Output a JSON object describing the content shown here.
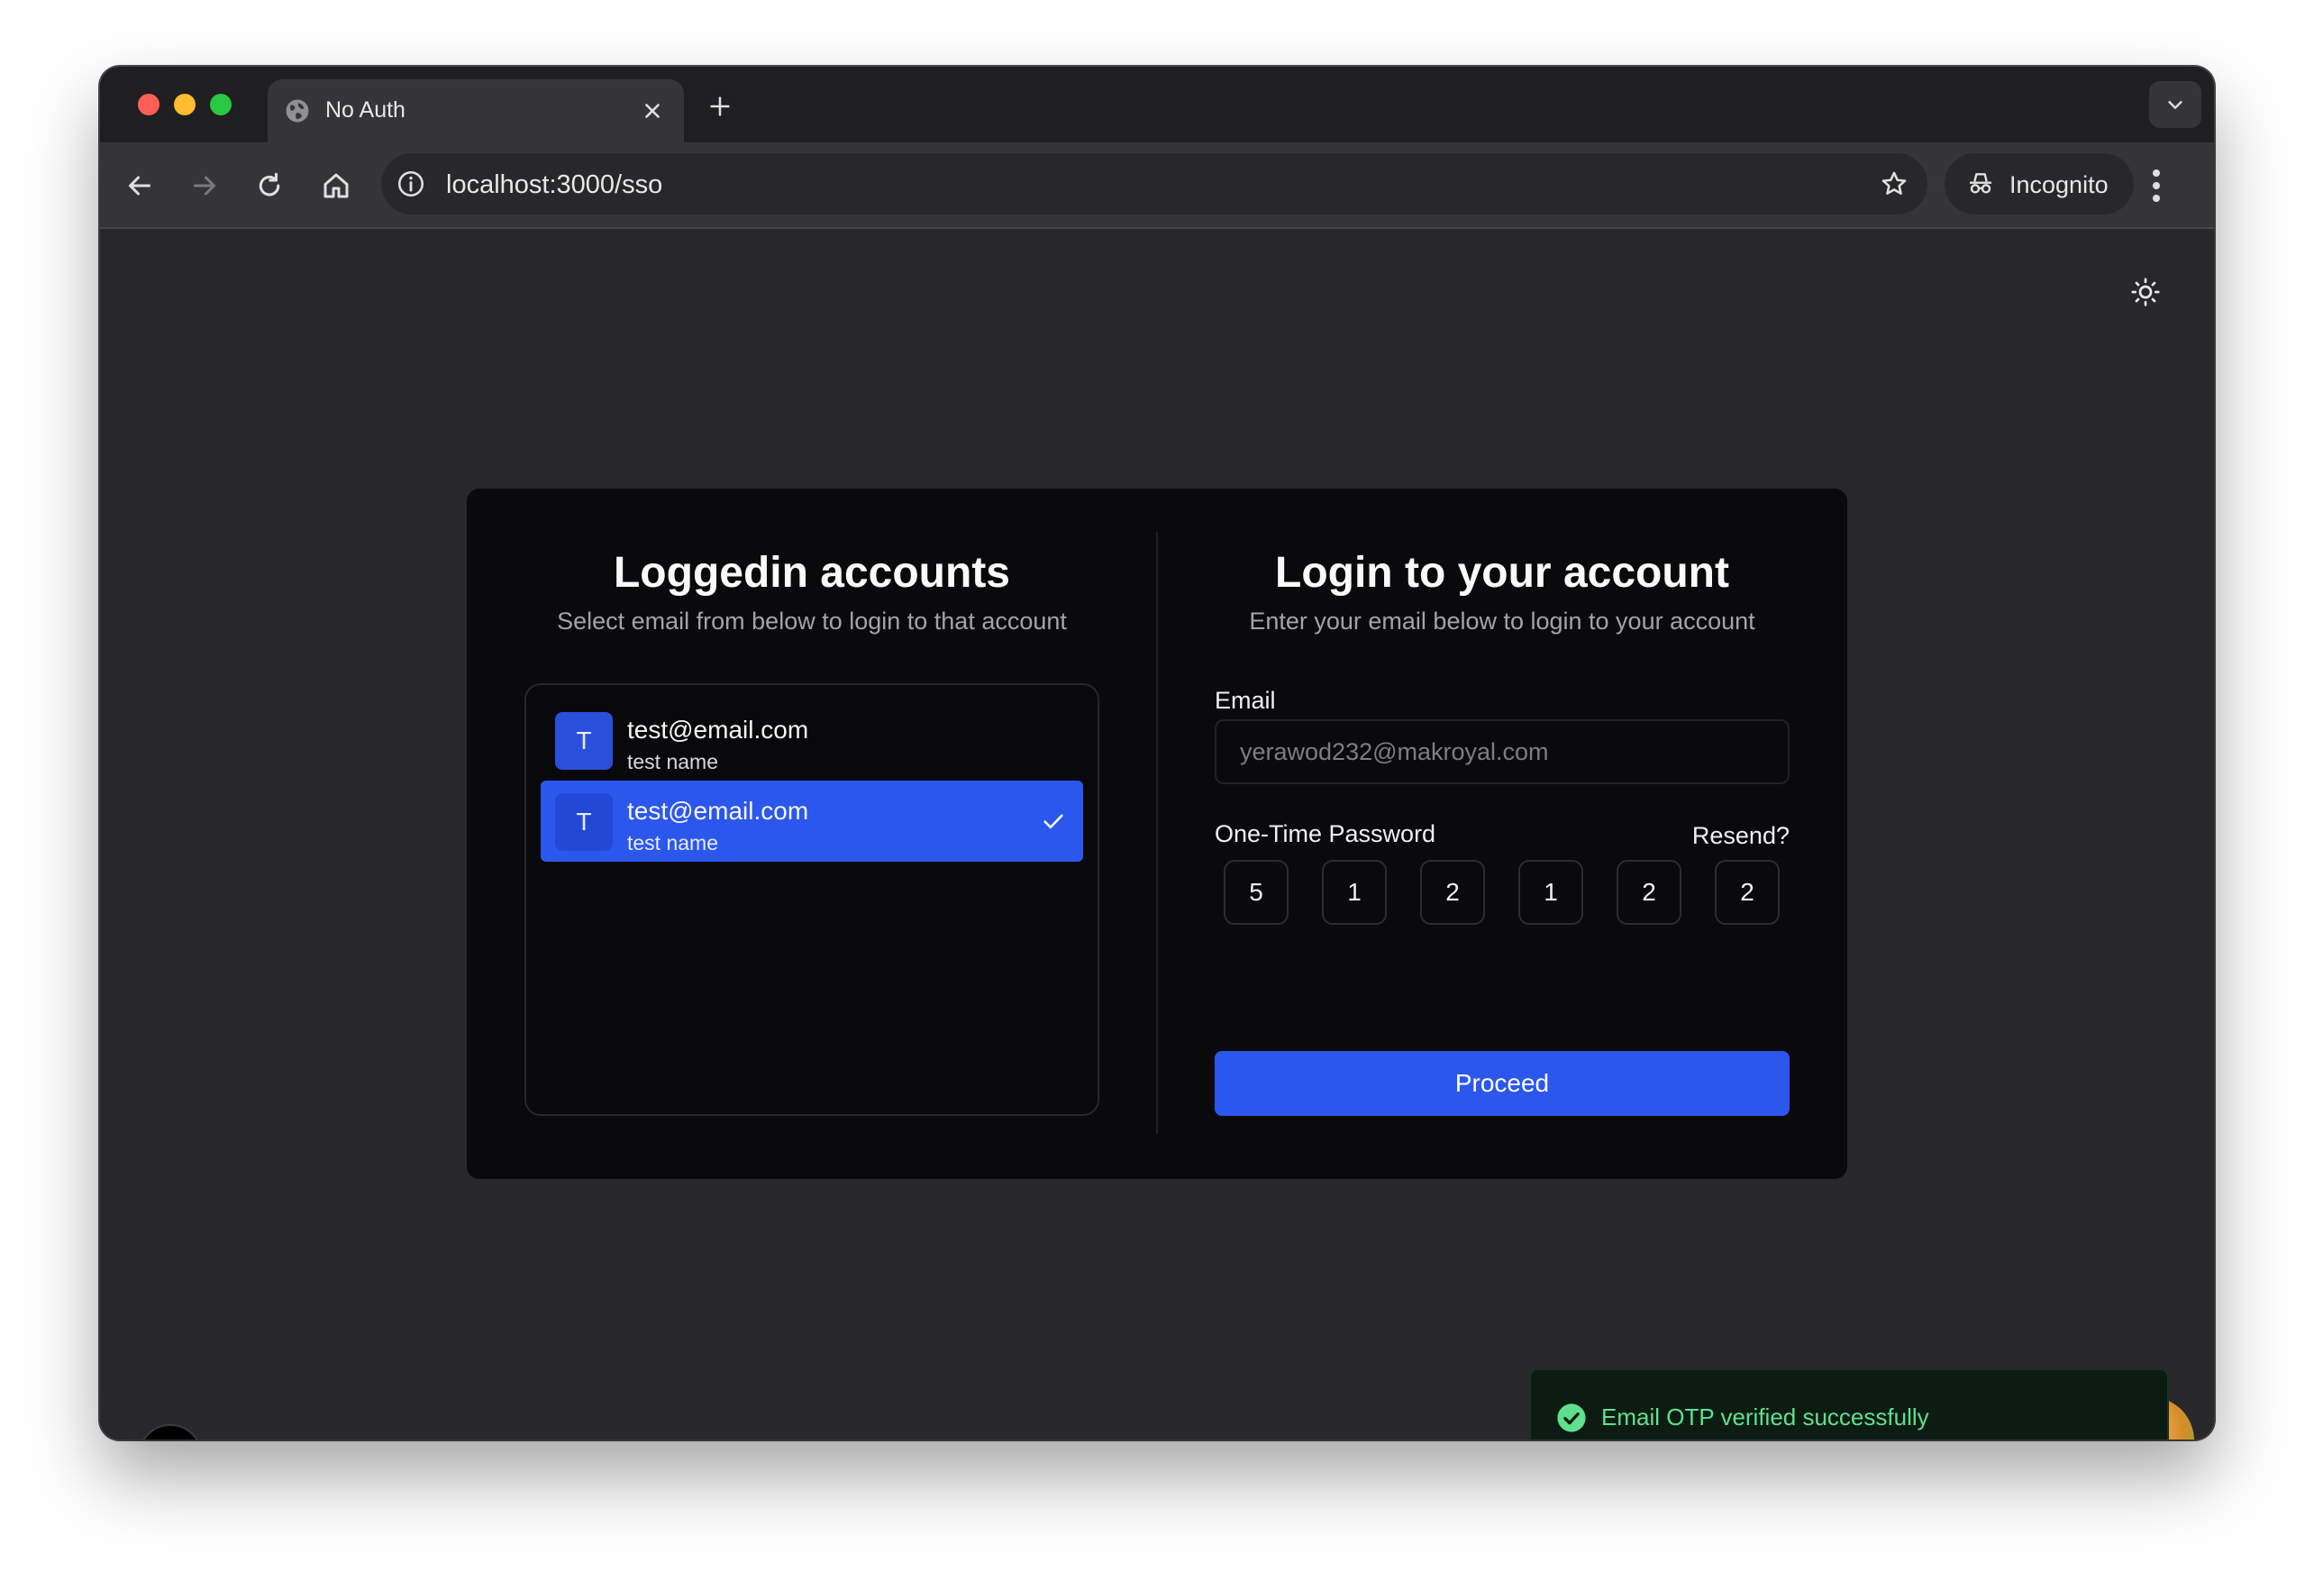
{
  "browser": {
    "tab": {
      "title": "No Auth",
      "icon": "globe-icon"
    },
    "url": "localhost:3000/sso",
    "incognito_label": "Incognito"
  },
  "left_panel": {
    "title": "Loggedin accounts",
    "subtitle": "Select email from below to login to that account",
    "accounts": [
      {
        "initial": "T",
        "email": "test@email.com",
        "name": "test name",
        "selected": false
      },
      {
        "initial": "T",
        "email": "test@email.com",
        "name": "test name",
        "selected": true
      }
    ]
  },
  "right_panel": {
    "title": "Login to your account",
    "subtitle": "Enter your email below to login to your account",
    "email_label": "Email",
    "email_placeholder": "yerawod232@makroyal.com",
    "otp_label": "One-Time Password",
    "resend_label": "Resend?",
    "otp_digits": [
      "5",
      "1",
      "2",
      "1",
      "2",
      "2"
    ],
    "proceed_label": "Proceed"
  },
  "toast": {
    "message": "Email OTP verified successfully",
    "icon": "check-circle-icon"
  },
  "colors": {
    "accent": "#2b57ed",
    "success": "#5fe08f",
    "card_bg": "#0a0a0c",
    "page_bg": "#28282b"
  }
}
